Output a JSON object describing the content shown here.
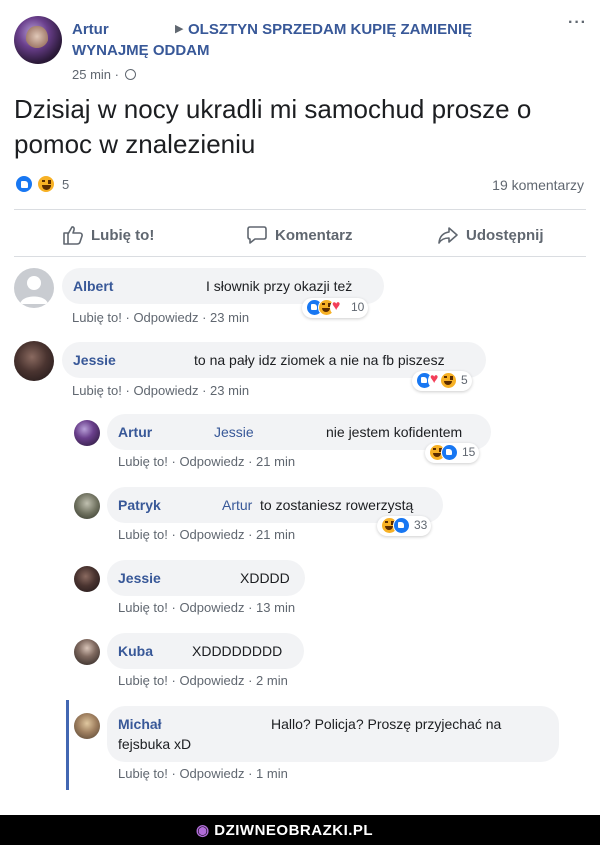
{
  "post": {
    "author": "Artur",
    "group_line1": "OLSZTYN SPRZEDAM KUPIĘ ZAMIENIĘ",
    "group_line2": "WYNAJMĘ ODDAM",
    "time": "25 min ·",
    "more": "···",
    "text": "Dzisiaj w nocy ukradli mi samochud prosze o pomoc w znalezieniu",
    "reaction_count": "5",
    "comments_count": "19 komentarzy",
    "actions": {
      "like": "Lubię to!",
      "comment": "Komentarz",
      "share": "Udostępnij"
    }
  },
  "comments": [
    {
      "name": "Albert",
      "text": "I słownik przy okazji też",
      "like": "Lubię to!",
      "reply": "Odpowiedz",
      "time": "23 min",
      "reactions": "10"
    },
    {
      "name": "Jessie",
      "text": "to na pały idz ziomek a nie na fb piszesz",
      "like": "Lubię to!",
      "reply": "Odpowiedz",
      "time": "23 min",
      "reactions": "5"
    },
    {
      "name": "Artur",
      "mention": "Jessie",
      "text": "nie jestem kofidentem",
      "like": "Lubię to!",
      "reply": "Odpowiedz",
      "time": "21 min",
      "reactions": "15"
    },
    {
      "name": "Patryk",
      "mention": "Artur",
      "text": "to zostaniesz rowerzystą",
      "like": "Lubię to!",
      "reply": "Odpowiedz",
      "time": "21 min",
      "reactions": "33"
    },
    {
      "name": "Jessie",
      "text": "XDDDD",
      "like": "Lubię to!",
      "reply": "Odpowiedz",
      "time": "13 min"
    },
    {
      "name": "Kuba",
      "text": "XDDDDDDDD",
      "like": "Lubię to!",
      "reply": "Odpowiedz",
      "time": "2 min"
    },
    {
      "name": "Michał",
      "text": "Hallo? Policja? Proszę przyjechać na",
      "text2": "fejsbuka xD",
      "like": "Lubię to!",
      "reply": "Odpowiedz",
      "time": "1 min"
    }
  ],
  "footer": {
    "brand": "DZIWNEOBRAZKI.PL"
  },
  "colors": {
    "link": "#385898",
    "meta": "#606770",
    "bubble": "#f2f3f5",
    "like": "#1877f2",
    "haha": "#f7b125",
    "love": "#f33e58"
  },
  "icons": [
    "like-icon",
    "haha-icon",
    "love-icon",
    "globe-icon",
    "comment-icon",
    "share-icon",
    "thumb-icon"
  ]
}
